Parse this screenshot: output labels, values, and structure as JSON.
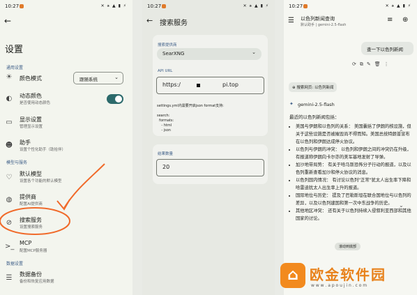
{
  "s1": {
    "status_time": "10:27",
    "status_icons": "✕ ⚹ ▲ ▮ ⚡",
    "back_icon": "arrow-left-icon",
    "title": "设置",
    "section_general": "通用设置",
    "color_mode": {
      "title": "颜色模式",
      "value": "跟随系统"
    },
    "dynamic_color": {
      "title": "动态颜色",
      "subtitle": "是否使用动态颜色"
    },
    "display": {
      "title": "显示设置",
      "subtitle": "管理显示设置"
    },
    "assistant": {
      "title": "助手",
      "subtitle": "设置个性化助手（助拾伴）"
    },
    "section_model": "模型与服务",
    "default_model": {
      "title": "默认模型",
      "subtitle": "设置各个功能的默认模型"
    },
    "provider": {
      "title": "提供商",
      "subtitle": "配置AI提供商"
    },
    "search_service": {
      "title": "搜索服务",
      "subtitle": "设置搜索服务"
    },
    "mcp": {
      "title": "MCP",
      "subtitle": "配置MCP服务器"
    },
    "section_data": "数据设置",
    "backup": {
      "title": "数据备份",
      "subtitle": "备份和恢复应用数据"
    }
  },
  "s2": {
    "status_time": "10:27",
    "title": "搜索服务",
    "provider_label": "搜索提供商",
    "provider_value": "SearXNG",
    "api_url_label": "API URL",
    "api_url_value": "https:/",
    "api_url_tail": "pi.top",
    "hint_title": "settings.yml内需要开启json format支持:",
    "hint_code": [
      "search:",
      "  formats:",
      "    - html",
      "    - json"
    ],
    "result_label": "结果数量",
    "result_value": "20"
  },
  "s3": {
    "status_time": "10:27",
    "header_title": "以色列新闻查询",
    "header_sub": "默认助手 | gemini-2.5-flash",
    "user_message": "查一下以色列新闻",
    "search_chip": "搜索网页: 以色列新闻",
    "model_name": "gemini-2.5-flash",
    "intro": "最近的以色列新闻包括：",
    "bullets": [
      "美国与伊朗和以色列的关系： 美国囊括了伊朗的核设施，但关于这些设施是否被摧毁尚不得而知。美国总统特朗普宣布在以色列和伊朗达成停火协议。",
      "以色列与伊朗的冲突： 以色列和伊朗之间的冲突仍在升级，有报道称伊朗向卡尔亦的美军基地发射了导弹。",
      "加沙地带局势： 有关于哈马斯恐怖分子行动的报道，以及以色列重新查看加沙和停火协议的消息。",
      "以色列国内情况： 有讨论以色列\"正常\"犹太人出生率下降和哈雷迪犹太人出生率上升的报道。",
      "国际地位与历史： 提及了巴勒斯坦在联合国地位与以色列的差异，以及以色列建国和第一次中东战争的历史。",
      "其他地区冲突： 还有关于以色列持续入侵叙利亚西部和其他国家的讨论。"
    ],
    "scroll_label": "滚动到底部"
  },
  "watermark": {
    "brand": "欧金软件园",
    "url": "w w w . a p o u j i n . c o m"
  },
  "colors": {
    "accent": "#2c6a6b",
    "annotation": "#f06a2a",
    "section": "#3f5f88"
  }
}
